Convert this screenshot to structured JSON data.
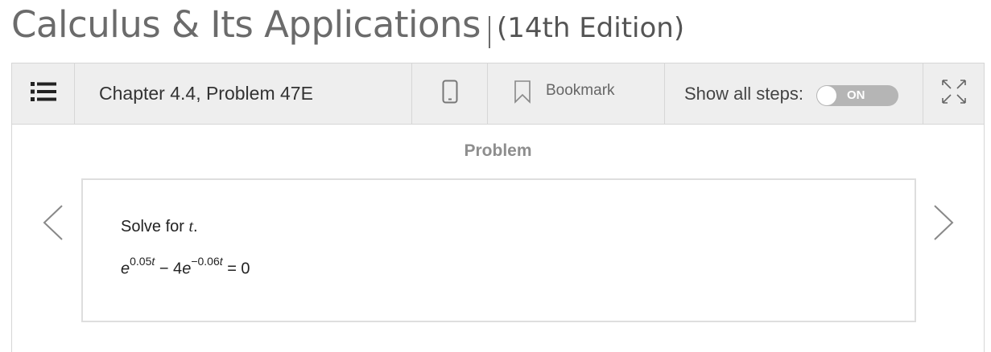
{
  "book": {
    "title": "Calculus & Its Applications",
    "edition": "(14th Edition)"
  },
  "toolbar": {
    "chapter_label": "Chapter 4.4, Problem 47E",
    "bookmark_label": "Bookmark",
    "show_steps_label": "Show all steps:",
    "toggle_state": "ON"
  },
  "problem": {
    "section_label": "Problem",
    "instruction_prefix": "Solve for ",
    "instruction_var": "t",
    "instruction_suffix": ".",
    "equation": {
      "base1": "e",
      "exp1_num": "0.05",
      "exp1_var": "t",
      "middle": " − 4",
      "base2": "e",
      "exp2_num": "−0.06",
      "exp2_var": "t",
      "rhs": " = 0"
    }
  },
  "icons": {
    "menu": "list-icon",
    "mobile": "phone-icon",
    "bookmark": "bookmark-icon",
    "expand": "expand-icon",
    "prev": "chevron-left-icon",
    "next": "chevron-right-icon"
  },
  "colors": {
    "toolbar_bg": "#eeeeee",
    "toggle_bg": "#b5b5b5",
    "title_text": "#6b6b6b"
  }
}
